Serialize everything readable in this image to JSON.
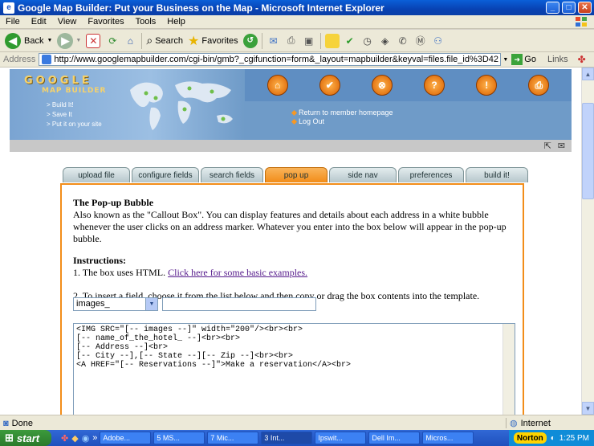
{
  "window": {
    "title": "Google Map Builder: Put your Business on the Map - Microsoft Internet Explorer"
  },
  "menu": [
    "File",
    "Edit",
    "View",
    "Favorites",
    "Tools",
    "Help"
  ],
  "toolbar": {
    "back": "Back",
    "search": "Search",
    "favorites": "Favorites"
  },
  "address": {
    "label": "Address",
    "url": "http://www.googlemapbuilder.com/cgi-bin/gmb?_cgifunction=form&_layout=mapbuilder&keyval=files.file_id%3D42",
    "go": "Go",
    "links": "Links"
  },
  "banner": {
    "logo_line1": "GOOGLE",
    "logo_line2": "MAP BUILDER",
    "taglines": [
      "> Build It!",
      "> Save It",
      "> Put it on your site"
    ],
    "member_links": [
      "Return to member homepage",
      "Log Out"
    ]
  },
  "tabs": [
    "upload file",
    "configure fields",
    "search fields",
    "pop up",
    "side nav",
    "preferences",
    "build it!"
  ],
  "active_tab": "pop up",
  "panel": {
    "heading": "The Pop-up Bubble",
    "intro": "Also known as the \"Callout Box\". You can display features and details about each address in a white bubble whenever the user clicks on an address marker. Whatever you enter into the box below will appear in the pop-up bubble.",
    "instructions_heading": "Instructions:",
    "step1_text": "1. The box uses HTML. ",
    "step1_link": "Click here for some basic examples.",
    "step2_text": "2. To insert a field, choose it from the list below and then copy or drag the box contents into the template.",
    "field_select": "images_",
    "field_value": "",
    "template": "<IMG SRC=\"[-- images --]\" width=\"200\"/><br><br>\n[-- name_of_the_hotel_ --]<br><br>\n[-- Address --]<br>\n[-- City --],[-- State --][-- Zip --]<br><br>\n<A HREF=\"[-- Reservations --]\">Make a reservation</A><br>"
  },
  "status": {
    "text": "Done",
    "zone": "Internet"
  },
  "taskbar": {
    "start": "start",
    "tasks": [
      "Adobe...",
      "5 MS...",
      "7 Mic...",
      "3 Int...",
      "Ipswit...",
      "Dell Im...",
      "Micros..."
    ],
    "norton": "Norton",
    "clock": "1:25 PM"
  },
  "colors": {
    "accent_orange": "#f28d19",
    "banner_blue": "#6f9bc8"
  }
}
